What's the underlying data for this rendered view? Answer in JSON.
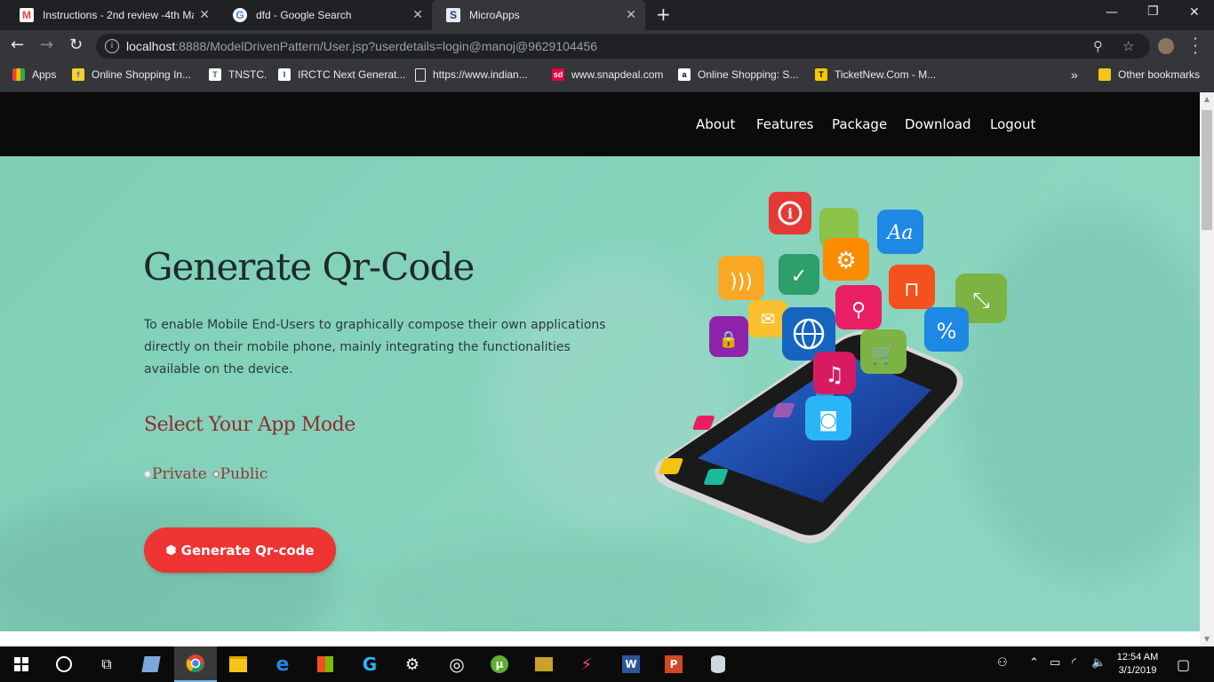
{
  "browser": {
    "tabs": [
      {
        "title": "Instructions - 2nd review -4th Ma",
        "icon": "gmail-icon",
        "active": false
      },
      {
        "title": "dfd - Google Search",
        "icon": "google-icon",
        "active": false
      },
      {
        "title": "MicroApps",
        "icon": "site-s-icon",
        "active": true
      }
    ],
    "url_host": "localhost",
    "url_rest": ":8888/ModelDrivenPattern/User.jsp?userdetails=login@manoj@9629104456",
    "bookmarks": [
      {
        "label": "Apps",
        "icon": "apps-grid-icon"
      },
      {
        "label": "Online Shopping In...",
        "icon": "flipkart-icon"
      },
      {
        "label": "TNSTC.",
        "icon": "tnstc-icon"
      },
      {
        "label": "IRCTC Next Generat...",
        "icon": "irctc-icon"
      },
      {
        "label": "https://www.indian...",
        "icon": "page-icon"
      },
      {
        "label": "www.snapdeal.com",
        "icon": "snapdeal-icon"
      },
      {
        "label": "Online Shopping: S...",
        "icon": "amazon-icon"
      },
      {
        "label": "TicketNew.Com - M...",
        "icon": "ticketnew-icon"
      }
    ],
    "other_bookmarks": "Other bookmarks",
    "overflow": "»"
  },
  "site_nav": {
    "items": [
      "About",
      "Features",
      "Package",
      "Download",
      "Logout"
    ]
  },
  "hero": {
    "title": "Generate Qr-Code",
    "description": "To enable Mobile End-Users to graphically compose their own applications directly on their mobile phone, mainly integrating the functionalities available on the device.",
    "mode_title": "Select Your App Mode",
    "mode_options": [
      {
        "label": "Private",
        "checked": false
      },
      {
        "label": "Public",
        "checked": true
      }
    ],
    "button_label": "Generate Qr-code"
  },
  "taskbar": {
    "time": "12:54 AM",
    "date": "3/1/2019"
  },
  "colors": {
    "hero_bg": "#86d3bc",
    "button": "#ee3333",
    "mode_title": "#8e2e2e",
    "nav_bg": "#0b0b0b"
  }
}
